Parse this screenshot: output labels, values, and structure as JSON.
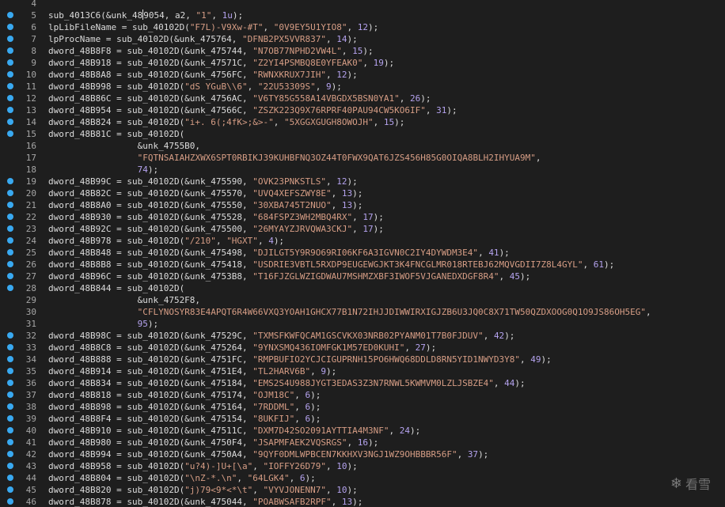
{
  "editor": {
    "lines": [
      {
        "n": "4",
        "bp": false,
        "parts": [
          {
            "t": ""
          }
        ]
      },
      {
        "n": "5",
        "bp": true,
        "parts": [
          {
            "t": "sub_4013C6(&unk_48"
          },
          {
            "t": "",
            "c": "cursor"
          },
          {
            "t": "9054, a2, "
          },
          {
            "t": "\"1\"",
            "c": "str"
          },
          {
            "t": ", "
          },
          {
            "t": "1u",
            "c": "num"
          },
          {
            "t": ");"
          }
        ]
      },
      {
        "n": "6",
        "bp": true,
        "parts": [
          {
            "t": "lpLibFileName = sub_40102D("
          },
          {
            "t": "\"F7L)-V9Xw-#T\"",
            "c": "str"
          },
          {
            "t": ", "
          },
          {
            "t": "\"0V9EY5U1YIO8\"",
            "c": "str"
          },
          {
            "t": ", "
          },
          {
            "t": "12",
            "c": "num"
          },
          {
            "t": ");"
          }
        ]
      },
      {
        "n": "7",
        "bp": true,
        "parts": [
          {
            "t": "lpProcName = sub_40102D(&unk_475764, "
          },
          {
            "t": "\"DFNB2PX5VVR837\"",
            "c": "str"
          },
          {
            "t": ", "
          },
          {
            "t": "14",
            "c": "num"
          },
          {
            "t": ");"
          }
        ]
      },
      {
        "n": "8",
        "bp": true,
        "parts": [
          {
            "t": "dword_48B8F8 = sub_40102D(&unk_475744, "
          },
          {
            "t": "\"N7OB77NPHD2VW4L\"",
            "c": "str"
          },
          {
            "t": ", "
          },
          {
            "t": "15",
            "c": "num"
          },
          {
            "t": ");"
          }
        ]
      },
      {
        "n": "9",
        "bp": true,
        "parts": [
          {
            "t": "dword_48B918 = sub_40102D(&unk_47571C, "
          },
          {
            "t": "\"Z2YI4PSMBQ8E0YFEAK0\"",
            "c": "str"
          },
          {
            "t": ", "
          },
          {
            "t": "19",
            "c": "num"
          },
          {
            "t": ");"
          }
        ]
      },
      {
        "n": "10",
        "bp": true,
        "parts": [
          {
            "t": "dword_48B8A8 = sub_40102D(&unk_4756FC, "
          },
          {
            "t": "\"RWNXKRUX7JIH\"",
            "c": "str"
          },
          {
            "t": ", "
          },
          {
            "t": "12",
            "c": "num"
          },
          {
            "t": ");"
          }
        ]
      },
      {
        "n": "11",
        "bp": true,
        "parts": [
          {
            "t": "dword_48B998 = sub_40102D("
          },
          {
            "t": "\"dS YGuB\\\\6\"",
            "c": "str"
          },
          {
            "t": ", "
          },
          {
            "t": "\"22U53309S\"",
            "c": "str"
          },
          {
            "t": ", "
          },
          {
            "t": "9",
            "c": "num"
          },
          {
            "t": ");"
          }
        ]
      },
      {
        "n": "12",
        "bp": true,
        "parts": [
          {
            "t": "dword_48B86C = sub_40102D(&unk_4756AC, "
          },
          {
            "t": "\"V6TY85G558A14VBGDX5BSN0YA1\"",
            "c": "str"
          },
          {
            "t": ", "
          },
          {
            "t": "26",
            "c": "num"
          },
          {
            "t": ");"
          }
        ]
      },
      {
        "n": "13",
        "bp": true,
        "parts": [
          {
            "t": "dword_48B954 = sub_40102D(&unk_47566C, "
          },
          {
            "t": "\"ZSZK223Q9X76RPRF40PAU94CW5KO6IF\"",
            "c": "str"
          },
          {
            "t": ", "
          },
          {
            "t": "31",
            "c": "num"
          },
          {
            "t": ");"
          }
        ]
      },
      {
        "n": "14",
        "bp": true,
        "parts": [
          {
            "t": "dword_48B824 = sub_40102D("
          },
          {
            "t": "\"i+. 6(;4fK>;&>-\"",
            "c": "str"
          },
          {
            "t": ", "
          },
          {
            "t": "\"5XGGXGUGH8OWOJH\"",
            "c": "str"
          },
          {
            "t": ", "
          },
          {
            "t": "15",
            "c": "num"
          },
          {
            "t": ");"
          }
        ]
      },
      {
        "n": "15",
        "bp": true,
        "parts": [
          {
            "t": "dword_48B81C = sub_40102D("
          }
        ]
      },
      {
        "n": "16",
        "bp": false,
        "parts": [
          {
            "t": "                 &unk_4755B0,"
          }
        ]
      },
      {
        "n": "17",
        "bp": false,
        "parts": [
          {
            "t": "                 "
          },
          {
            "t": "\"FQTNSAIAHZXWX6SPT0RBIKJ39KUHBFNQ3OZ44T0FWX9QAT6JZS456H85G0OIQA8BLH2IHYUA9M\"",
            "c": "str"
          },
          {
            "t": ","
          }
        ]
      },
      {
        "n": "18",
        "bp": false,
        "parts": [
          {
            "t": "                 "
          },
          {
            "t": "74",
            "c": "num"
          },
          {
            "t": ");"
          }
        ]
      },
      {
        "n": "19",
        "bp": true,
        "parts": [
          {
            "t": "dword_48B99C = sub_40102D(&unk_475590, "
          },
          {
            "t": "\"OVK23PNKSTLS\"",
            "c": "str"
          },
          {
            "t": ", "
          },
          {
            "t": "12",
            "c": "num"
          },
          {
            "t": ");"
          }
        ]
      },
      {
        "n": "20",
        "bp": true,
        "parts": [
          {
            "t": "dword_48B82C = sub_40102D(&unk_475570, "
          },
          {
            "t": "\"UVQ4XEFSZWY8E\"",
            "c": "str"
          },
          {
            "t": ", "
          },
          {
            "t": "13",
            "c": "num"
          },
          {
            "t": ");"
          }
        ]
      },
      {
        "n": "21",
        "bp": true,
        "parts": [
          {
            "t": "dword_48B8A0 = sub_40102D(&unk_475550, "
          },
          {
            "t": "\"30XBA745T2NUO\"",
            "c": "str"
          },
          {
            "t": ", "
          },
          {
            "t": "13",
            "c": "num"
          },
          {
            "t": ");"
          }
        ]
      },
      {
        "n": "22",
        "bp": true,
        "parts": [
          {
            "t": "dword_48B930 = sub_40102D(&unk_475528, "
          },
          {
            "t": "\"684FSPZ3WH2MBQ4RX\"",
            "c": "str"
          },
          {
            "t": ", "
          },
          {
            "t": "17",
            "c": "num"
          },
          {
            "t": ");"
          }
        ]
      },
      {
        "n": "23",
        "bp": true,
        "parts": [
          {
            "t": "dword_48B92C = sub_40102D(&unk_475500, "
          },
          {
            "t": "\"26MYAYZJRVQWA3CKJ\"",
            "c": "str"
          },
          {
            "t": ", "
          },
          {
            "t": "17",
            "c": "num"
          },
          {
            "t": ");"
          }
        ]
      },
      {
        "n": "24",
        "bp": true,
        "parts": [
          {
            "t": "dword_48B978 = sub_40102D("
          },
          {
            "t": "\"/210\"",
            "c": "str"
          },
          {
            "t": ", "
          },
          {
            "t": "\"HGXT\"",
            "c": "str"
          },
          {
            "t": ", "
          },
          {
            "t": "4",
            "c": "num"
          },
          {
            "t": ");"
          }
        ]
      },
      {
        "n": "25",
        "bp": true,
        "parts": [
          {
            "t": "dword_48B848 = sub_40102D(&unk_475498, "
          },
          {
            "t": "\"DJILGT5Y9R9O69RI06KF6A3IGVN0C2IY4DYWDM3E4\"",
            "c": "str"
          },
          {
            "t": ", "
          },
          {
            "t": "41",
            "c": "num"
          },
          {
            "t": ");"
          }
        ]
      },
      {
        "n": "26",
        "bp": true,
        "parts": [
          {
            "t": "dword_48B8B8 = sub_40102D(&unk_475418, "
          },
          {
            "t": "\"USDRIE3VBTL5RXDP9EUGEWGJKT3K4FNCGLMR018RTEBJ62MQVGDII7Z8L4GYL\"",
            "c": "str"
          },
          {
            "t": ", "
          },
          {
            "t": "61",
            "c": "num"
          },
          {
            "t": ");"
          }
        ]
      },
      {
        "n": "27",
        "bp": true,
        "parts": [
          {
            "t": "dword_48B96C = sub_40102D(&unk_4753B8, "
          },
          {
            "t": "\"T16FJZGLWZIGDWAU7MSHMZXBF3IWOF5VJGANEDXDGF8R4\"",
            "c": "str"
          },
          {
            "t": ", "
          },
          {
            "t": "45",
            "c": "num"
          },
          {
            "t": ");"
          }
        ]
      },
      {
        "n": "28",
        "bp": true,
        "parts": [
          {
            "t": "dword_48B844 = sub_40102D("
          }
        ]
      },
      {
        "n": "29",
        "bp": false,
        "parts": [
          {
            "t": "                 &unk_4752F8,"
          }
        ]
      },
      {
        "n": "30",
        "bp": false,
        "parts": [
          {
            "t": "                 "
          },
          {
            "t": "\"CFLYNOSYR83E4APQT6R4W66VXQ3YOAH1GHCX77B1N72IHJJDIWWIRXIGJZB6U3JQ0C8X71TW50QZDXOOG0Q1O9JS86OH5EG\"",
            "c": "str"
          },
          {
            "t": ","
          }
        ]
      },
      {
        "n": "31",
        "bp": false,
        "parts": [
          {
            "t": "                 "
          },
          {
            "t": "95",
            "c": "num"
          },
          {
            "t": ");"
          }
        ]
      },
      {
        "n": "32",
        "bp": true,
        "parts": [
          {
            "t": "dword_48B98C = sub_40102D(&unk_47529C, "
          },
          {
            "t": "\"TXMSFKWFQCAM1GSCVKX03NRB02PYANM01T7B0FJDUV\"",
            "c": "str"
          },
          {
            "t": ", "
          },
          {
            "t": "42",
            "c": "num"
          },
          {
            "t": ");"
          }
        ]
      },
      {
        "n": "33",
        "bp": true,
        "parts": [
          {
            "t": "dword_48B8C8 = sub_40102D(&unk_475264, "
          },
          {
            "t": "\"9YNXSMQ436IOMFGK1M57ED0KUHI\"",
            "c": "str"
          },
          {
            "t": ", "
          },
          {
            "t": "27",
            "c": "num"
          },
          {
            "t": ");"
          }
        ]
      },
      {
        "n": "34",
        "bp": true,
        "parts": [
          {
            "t": "dword_48B888 = sub_40102D(&unk_4751FC, "
          },
          {
            "t": "\"RMPBUFIO2YCJCIGUPRNH15PO6HWQ68DDLD8RN5YID1NWYD3Y8\"",
            "c": "str"
          },
          {
            "t": ", "
          },
          {
            "t": "49",
            "c": "num"
          },
          {
            "t": ");"
          }
        ]
      },
      {
        "n": "35",
        "bp": true,
        "parts": [
          {
            "t": "dword_48B914 = sub_40102D(&unk_4751E4, "
          },
          {
            "t": "\"TL2HARV6B\"",
            "c": "str"
          },
          {
            "t": ", "
          },
          {
            "t": "9",
            "c": "num"
          },
          {
            "t": ");"
          }
        ]
      },
      {
        "n": "36",
        "bp": true,
        "parts": [
          {
            "t": "dword_48B834 = sub_40102D(&unk_475184, "
          },
          {
            "t": "\"EMS2S4U988JYGT3EDAS3Z3N7RNWL5KWMVM0LZLJSBZE4\"",
            "c": "str"
          },
          {
            "t": ", "
          },
          {
            "t": "44",
            "c": "num"
          },
          {
            "t": ");"
          }
        ]
      },
      {
        "n": "37",
        "bp": true,
        "parts": [
          {
            "t": "dword_48B818 = sub_40102D(&unk_475174, "
          },
          {
            "t": "\"OJM18C\"",
            "c": "str"
          },
          {
            "t": ", "
          },
          {
            "t": "6",
            "c": "num"
          },
          {
            "t": ");"
          }
        ]
      },
      {
        "n": "38",
        "bp": true,
        "parts": [
          {
            "t": "dword_48B898 = sub_40102D(&unk_475164, "
          },
          {
            "t": "\"7RDDML\"",
            "c": "str"
          },
          {
            "t": ", "
          },
          {
            "t": "6",
            "c": "num"
          },
          {
            "t": ");"
          }
        ]
      },
      {
        "n": "39",
        "bp": true,
        "parts": [
          {
            "t": "dword_48B8F4 = sub_40102D(&unk_475154, "
          },
          {
            "t": "\"8UKFIJ\"",
            "c": "str"
          },
          {
            "t": ", "
          },
          {
            "t": "6",
            "c": "num"
          },
          {
            "t": ");"
          }
        ]
      },
      {
        "n": "40",
        "bp": true,
        "parts": [
          {
            "t": "dword_48B910 = sub_40102D(&unk_47511C, "
          },
          {
            "t": "\"DXM7D42SO2091AYTTIA4M3NF\"",
            "c": "str"
          },
          {
            "t": ", "
          },
          {
            "t": "24",
            "c": "num"
          },
          {
            "t": ");"
          }
        ]
      },
      {
        "n": "41",
        "bp": true,
        "parts": [
          {
            "t": "dword_48B980 = sub_40102D(&unk_4750F4, "
          },
          {
            "t": "\"JSAPMFAEK2VQSRGS\"",
            "c": "str"
          },
          {
            "t": ", "
          },
          {
            "t": "16",
            "c": "num"
          },
          {
            "t": ");"
          }
        ]
      },
      {
        "n": "42",
        "bp": true,
        "parts": [
          {
            "t": "dword_48B994 = sub_40102D(&unk_4750A4, "
          },
          {
            "t": "\"9QYF0DMLWPBCEN7KKHXV3NGJ1WZ9OHBBBR56F\"",
            "c": "str"
          },
          {
            "t": ", "
          },
          {
            "t": "37",
            "c": "num"
          },
          {
            "t": ");"
          }
        ]
      },
      {
        "n": "43",
        "bp": true,
        "parts": [
          {
            "t": "dword_48B958 = sub_40102D("
          },
          {
            "t": "\"u?4)-]U+[\\a\"",
            "c": "str"
          },
          {
            "t": ", "
          },
          {
            "t": "\"IOFFY26D79\"",
            "c": "str"
          },
          {
            "t": ", "
          },
          {
            "t": "10",
            "c": "num"
          },
          {
            "t": ");"
          }
        ]
      },
      {
        "n": "44",
        "bp": true,
        "parts": [
          {
            "t": "dword_48B804 = sub_40102D("
          },
          {
            "t": "\"\\nZ-*.\\n\"",
            "c": "str"
          },
          {
            "t": ", "
          },
          {
            "t": "\"64LGK4\"",
            "c": "str"
          },
          {
            "t": ", "
          },
          {
            "t": "6",
            "c": "num"
          },
          {
            "t": ");"
          }
        ]
      },
      {
        "n": "45",
        "bp": true,
        "parts": [
          {
            "t": "dword_48B820 = sub_40102D("
          },
          {
            "t": "\"j)79<9*<*\\t\"",
            "c": "str"
          },
          {
            "t": ", "
          },
          {
            "t": "\"VYVJONENN7\"",
            "c": "str"
          },
          {
            "t": ", "
          },
          {
            "t": "10",
            "c": "num"
          },
          {
            "t": ");"
          }
        ]
      },
      {
        "n": "46",
        "bp": true,
        "parts": [
          {
            "t": "dword_48B878 = sub_40102D(&unk_475044, "
          },
          {
            "t": "\"POABWSAFB2RPF\"",
            "c": "str"
          },
          {
            "t": ", "
          },
          {
            "t": "13",
            "c": "num"
          },
          {
            "t": ");"
          }
        ]
      }
    ]
  },
  "watermark": {
    "icon": "snowflake-icon",
    "text": "看雪"
  },
  "colors": {
    "background": "#1e1e1e",
    "breakpoint": "#39a9f0",
    "text": "#dcdcdc",
    "string": "#d69d85",
    "number": "#b5a3ef",
    "line_number": "#a6a6a6"
  }
}
